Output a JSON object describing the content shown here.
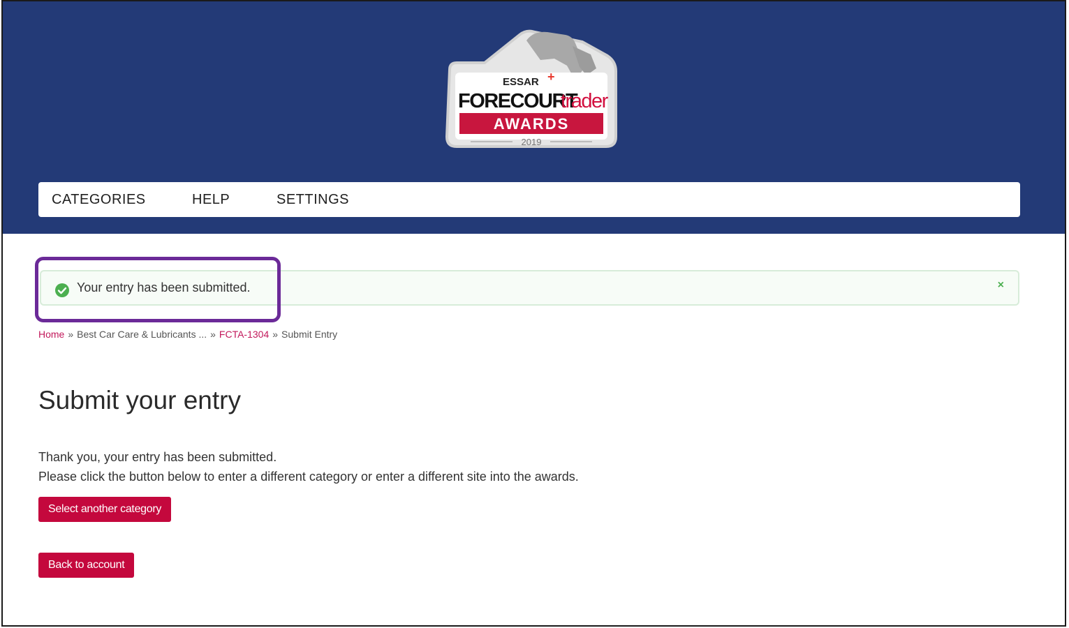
{
  "logo": {
    "brand": "ESSAR",
    "name_bold": "FORECOURT",
    "name_light": "trader",
    "banner": "AWARDS",
    "year": "2019"
  },
  "nav": {
    "items": [
      {
        "label": "CATEGORIES"
      },
      {
        "label": "HELP"
      },
      {
        "label": "SETTINGS"
      }
    ]
  },
  "alert": {
    "message": "Your entry has been submitted.",
    "close": "×",
    "icon": "check-circle-icon",
    "color": "#4caf50"
  },
  "breadcrumb": {
    "items": [
      {
        "label": "Home"
      },
      {
        "label": "Best Car Care & Lubricants ..."
      },
      {
        "label": "FCTA-1304"
      },
      {
        "label": "Submit Entry"
      }
    ],
    "separator": "»"
  },
  "main": {
    "title": "Submit your entry",
    "line1": "Thank you, your entry has been submitted.",
    "line2": "Please click the button below to enter a different category or enter a different site into the awards.",
    "select_button": "Select another category",
    "back_button": "Back to account"
  },
  "colors": {
    "header": "#233a77",
    "accent": "#c4083d",
    "highlight": "#6b2a98"
  }
}
